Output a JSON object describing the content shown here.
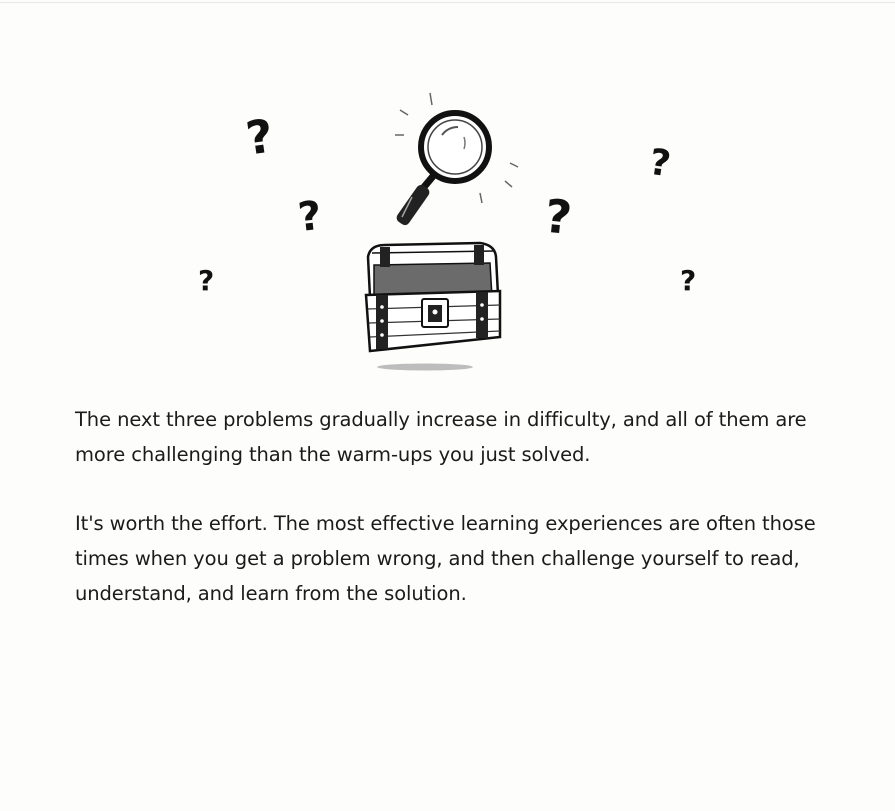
{
  "illustration": {
    "icons": [
      "question-mark-icon",
      "magnifying-glass-icon",
      "treasure-chest-icon"
    ],
    "question_glyph": "?"
  },
  "content": {
    "paragraph_1": "The next three problems gradually increase in difficulty, and all of them are more challenging than the warm-ups you just solved.",
    "paragraph_2": "It's worth the effort. The most effective learning experiences are often those times when you get a problem wrong, and then challenge yourself to read, understand, and learn from the solution."
  }
}
